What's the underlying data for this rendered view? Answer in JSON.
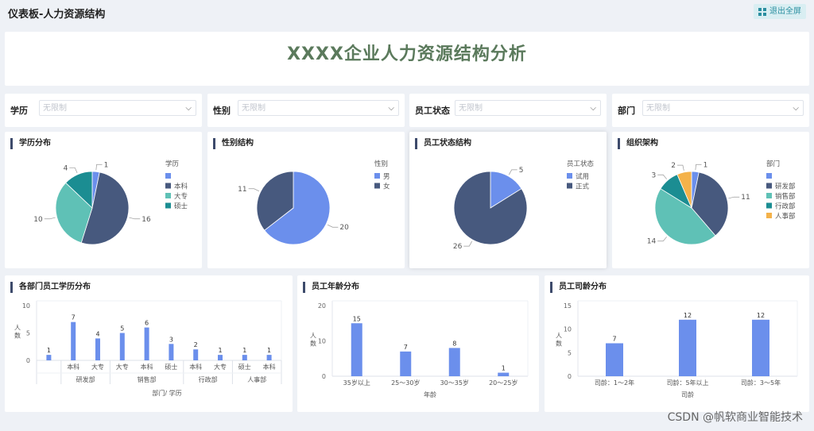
{
  "header": {
    "title": "仪表板-人力资源结构",
    "fullscreen_label": "退出全屏"
  },
  "banner": {
    "title": "XXXX企业人力资源结构分析"
  },
  "filters": [
    {
      "label": "学历",
      "placeholder": "无限制"
    },
    {
      "label": "性别",
      "placeholder": "无限制"
    },
    {
      "label": "员工状态",
      "placeholder": "无限制"
    },
    {
      "label": "部门",
      "placeholder": "无限制"
    }
  ],
  "panels": {
    "edu": "学历分布",
    "gender": "性别结构",
    "status": "员工状态结构",
    "org": "组织架构",
    "dept_edu": "各部门员工学历分布",
    "age": "员工年龄分布",
    "tenure": "员工司龄分布"
  },
  "watermark": "CSDN @帆软商业智能技术",
  "colors": {
    "blue": "#6b8fec",
    "navy": "#47597e",
    "teal": "#5fc1b6",
    "dteal": "#1b8d92",
    "orange": "#f4b24a"
  },
  "chart_data": [
    {
      "id": "edu",
      "type": "pie",
      "legend_title": "学历",
      "slices": [
        {
          "name": "",
          "value": 1,
          "color": "#6b8fec"
        },
        {
          "name": "本科",
          "value": 16,
          "color": "#47597e"
        },
        {
          "name": "大专",
          "value": 10,
          "color": "#5fc1b6"
        },
        {
          "name": "硕士",
          "value": 4,
          "color": "#1b8d92"
        }
      ]
    },
    {
      "id": "gender",
      "type": "pie",
      "legend_title": "性别",
      "slices": [
        {
          "name": "男",
          "value": 20,
          "color": "#6b8fec"
        },
        {
          "name": "女",
          "value": 11,
          "color": "#47597e"
        }
      ]
    },
    {
      "id": "status",
      "type": "pie",
      "legend_title": "员工状态",
      "slices": [
        {
          "name": "试用",
          "value": 5,
          "color": "#6b8fec"
        },
        {
          "name": "正式",
          "value": 26,
          "color": "#47597e"
        }
      ]
    },
    {
      "id": "org",
      "type": "pie",
      "legend_title": "部门",
      "slices": [
        {
          "name": "",
          "value": 1,
          "color": "#6b8fec"
        },
        {
          "name": "研发部",
          "value": 11,
          "color": "#47597e"
        },
        {
          "name": "销售部",
          "value": 14,
          "color": "#5fc1b6"
        },
        {
          "name": "行政部",
          "value": 3,
          "color": "#1b8d92"
        },
        {
          "name": "人事部",
          "value": 2,
          "color": "#f4b24a"
        }
      ]
    },
    {
      "id": "dept_edu",
      "type": "bar",
      "ylabel": "人数",
      "xlabel": "部门/ 学历",
      "ylim": [
        0,
        10
      ],
      "yticks": [
        0,
        5,
        10
      ],
      "bars": [
        {
          "label": "",
          "value": 1
        },
        {
          "label": "本科",
          "value": 7
        },
        {
          "label": "大专",
          "value": 4
        },
        {
          "label": "大专",
          "value": 5
        },
        {
          "label": "本科",
          "value": 6
        },
        {
          "label": "硕士",
          "value": 3
        },
        {
          "label": "本科",
          "value": 2
        },
        {
          "label": "大专",
          "value": 1
        },
        {
          "label": "硕士",
          "value": 1
        },
        {
          "label": "本科",
          "value": 1
        }
      ],
      "groups": [
        {
          "name": "",
          "span": 1
        },
        {
          "name": "研发部",
          "span": 2
        },
        {
          "name": "销售部",
          "span": 3
        },
        {
          "name": "行政部",
          "span": 2
        },
        {
          "name": "人事部",
          "span": 2
        }
      ]
    },
    {
      "id": "age",
      "type": "bar",
      "ylabel": "人数",
      "xlabel": "年龄",
      "ylim": [
        0,
        20
      ],
      "yticks": [
        0,
        10,
        20
      ],
      "bars": [
        {
          "label": "35岁以上",
          "value": 15
        },
        {
          "label": "25～30岁",
          "value": 7
        },
        {
          "label": "30～35岁",
          "value": 8
        },
        {
          "label": "20～25岁",
          "value": 1
        }
      ]
    },
    {
      "id": "tenure",
      "type": "bar",
      "ylabel": "人数",
      "xlabel": "司龄",
      "ylim": [
        0,
        15
      ],
      "yticks": [
        0,
        5,
        10,
        15
      ],
      "bars": [
        {
          "label": "司龄：1～2年",
          "value": 7
        },
        {
          "label": "司龄：5年以上",
          "value": 12
        },
        {
          "label": "司龄：3～5年",
          "value": 12
        }
      ]
    }
  ]
}
